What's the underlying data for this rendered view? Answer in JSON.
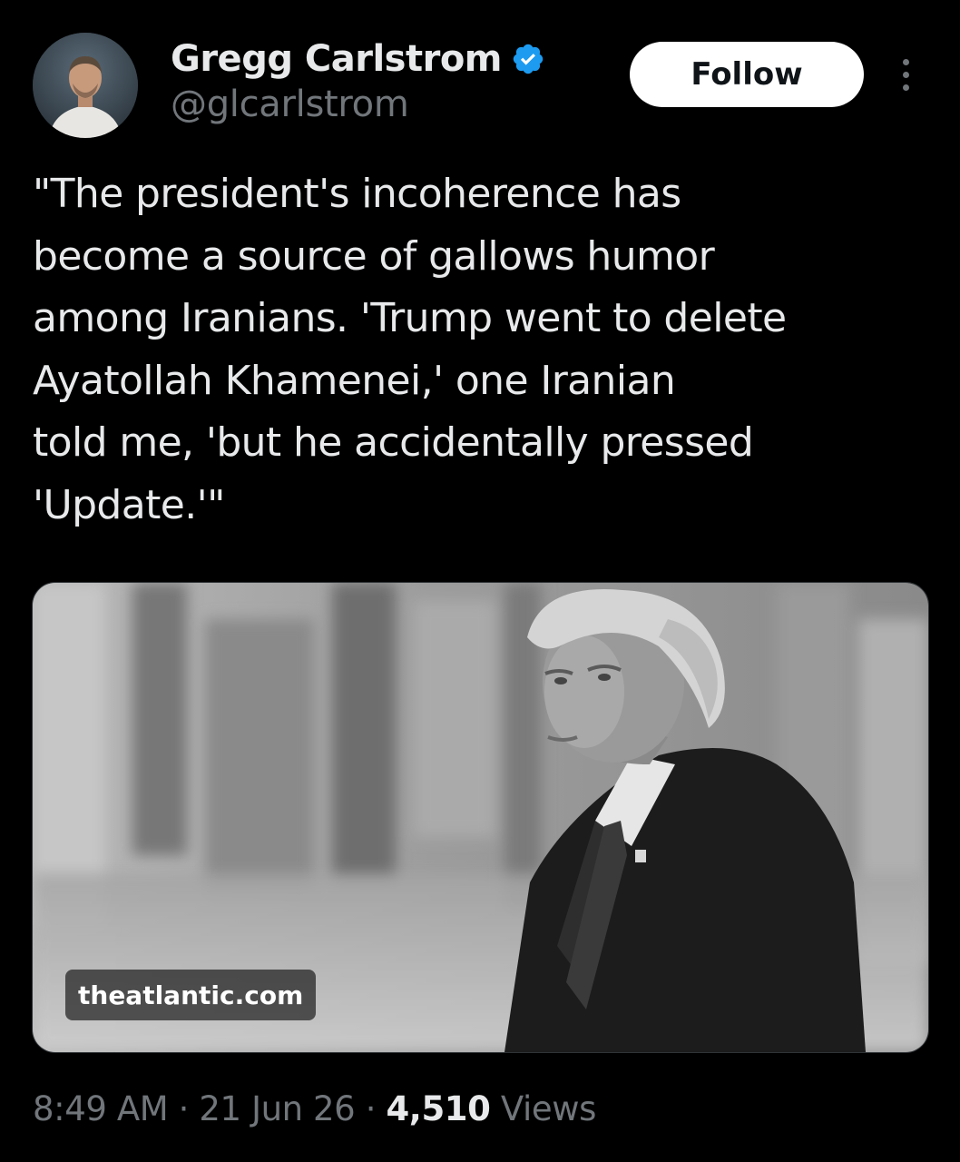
{
  "author": {
    "display_name": "Gregg Carlstrom",
    "handle": "@glcarlstrom",
    "verified": true,
    "verified_color": "#1d9bf0"
  },
  "actions": {
    "follow_label": "Follow",
    "more_icon": "more-vertical-icon"
  },
  "tweet": {
    "text": "\"The president's incoherence has\nbecome a source of gallows humor\namong Iranians. 'Trump went to delete\nAyatollah Khamenei,' one Iranian\ntold me, 'but he accidentally pressed\n'Update.'\""
  },
  "media": {
    "domain": "theatlantic.com"
  },
  "meta": {
    "time": "8:49 AM",
    "separator": "·",
    "date": "21 Jun 26",
    "views_count": "4,510",
    "views_label": "Views"
  },
  "colors": {
    "background": "#000000",
    "primary_text": "#e7e9ea",
    "secondary_text": "#71767b",
    "follow_button_bg": "#ffffff"
  }
}
